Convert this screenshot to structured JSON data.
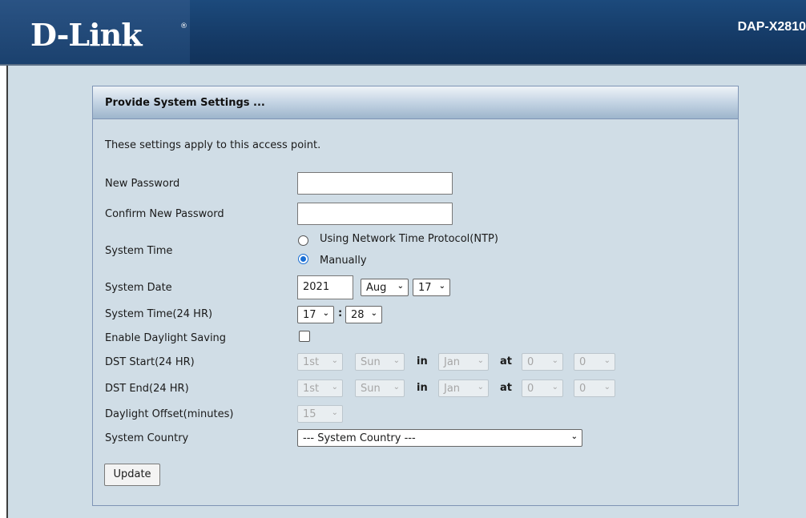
{
  "header": {
    "logo": "D-Link",
    "registered": "®",
    "model": "DAP-X2810"
  },
  "panel": {
    "title": "Provide System Settings ...",
    "intro": "These settings apply to this access point."
  },
  "labels": {
    "new_password": "New Password",
    "confirm_password": "Confirm New Password",
    "system_time": "System Time",
    "system_date": "System Date",
    "system_time_24": "System Time(24 HR)",
    "enable_dst": "Enable Daylight Saving",
    "dst_start": "DST Start(24 HR)",
    "dst_end": "DST End(24 HR)",
    "daylight_offset": "Daylight Offset(minutes)",
    "system_country": "System Country"
  },
  "fields": {
    "new_password": "",
    "confirm_password": ""
  },
  "system_time": {
    "options": [
      {
        "label": "Using Network Time Protocol(NTP)",
        "selected": false
      },
      {
        "label": "Manually",
        "selected": true
      }
    ]
  },
  "system_date": {
    "year": "2021",
    "month": "Aug",
    "day": "17"
  },
  "time24": {
    "hour": "17",
    "colon": ":",
    "minute": "28"
  },
  "dst": {
    "enabled": false,
    "in_label": "in",
    "at_label": "at",
    "start": {
      "week": "1st",
      "day": "Sun",
      "month": "Jan",
      "hour": "0",
      "minute": "0"
    },
    "end": {
      "week": "1st",
      "day": "Sun",
      "month": "Jan",
      "hour": "0",
      "minute": "0"
    },
    "offset": "15"
  },
  "country": {
    "selected": "--- System Country ---"
  },
  "buttons": {
    "update": "Update"
  },
  "colors": {
    "header_blue": "#153a66",
    "page_bg": "#cfdde6",
    "panel_border": "#7e94b5",
    "radio_accent": "#1a6fd4"
  }
}
